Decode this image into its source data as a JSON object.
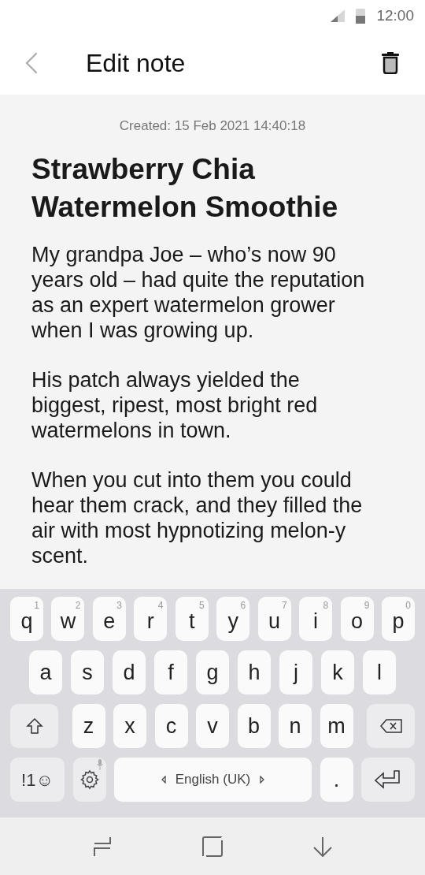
{
  "status_bar": {
    "time": "12:00"
  },
  "header": {
    "title": "Edit note"
  },
  "note": {
    "created": "Created: 15 Feb 2021 14:40:18",
    "title": "Strawberry Chia Watermelon Smoothie",
    "paragraphs": [
      "My grandpa Joe – who’s now 90 years old – had quite the reputation as an expert watermelon grower when I was growing up.",
      "His patch always yielded the biggest, ripest, most bright red watermelons in town.",
      "When you cut into them you could hear them crack, and they filled the air with most hypnotizing melon-y scent."
    ]
  },
  "keyboard": {
    "top_row": [
      {
        "kind": "letter",
        "label": "q",
        "hint": "1"
      },
      {
        "kind": "letter",
        "label": "w",
        "hint": "2"
      },
      {
        "kind": "letter",
        "label": "e",
        "hint": "3"
      },
      {
        "kind": "letter",
        "label": "r",
        "hint": "4"
      },
      {
        "kind": "letter",
        "label": "t",
        "hint": "5"
      },
      {
        "kind": "letter",
        "label": "y",
        "hint": "6"
      },
      {
        "kind": "letter",
        "label": "u",
        "hint": "7"
      },
      {
        "kind": "letter",
        "label": "i",
        "hint": "8"
      },
      {
        "kind": "letter",
        "label": "o",
        "hint": "9"
      },
      {
        "kind": "letter",
        "label": "p",
        "hint": "0"
      }
    ],
    "middle_row": [
      {
        "kind": "letter",
        "label": "a"
      },
      {
        "kind": "letter",
        "label": "s"
      },
      {
        "kind": "letter",
        "label": "d"
      },
      {
        "kind": "letter",
        "label": "f"
      },
      {
        "kind": "letter",
        "label": "g"
      },
      {
        "kind": "letter",
        "label": "h"
      },
      {
        "kind": "letter",
        "label": "j"
      },
      {
        "kind": "letter",
        "label": "k"
      },
      {
        "kind": "letter",
        "label": "l"
      }
    ],
    "lower_row": [
      {
        "kind": "shift"
      },
      {
        "kind": "letter",
        "label": "z"
      },
      {
        "kind": "letter",
        "label": "x"
      },
      {
        "kind": "letter",
        "label": "c"
      },
      {
        "kind": "letter",
        "label": "v"
      },
      {
        "kind": "letter",
        "label": "b"
      },
      {
        "kind": "letter",
        "label": "n"
      },
      {
        "kind": "letter",
        "label": "m"
      },
      {
        "kind": "backspace"
      }
    ],
    "bottom_row": [
      {
        "kind": "symbols",
        "label": "!1☺"
      },
      {
        "kind": "settings"
      },
      {
        "kind": "space",
        "label": "English (UK)"
      },
      {
        "kind": "letter",
        "label": "."
      },
      {
        "kind": "enter"
      }
    ]
  }
}
